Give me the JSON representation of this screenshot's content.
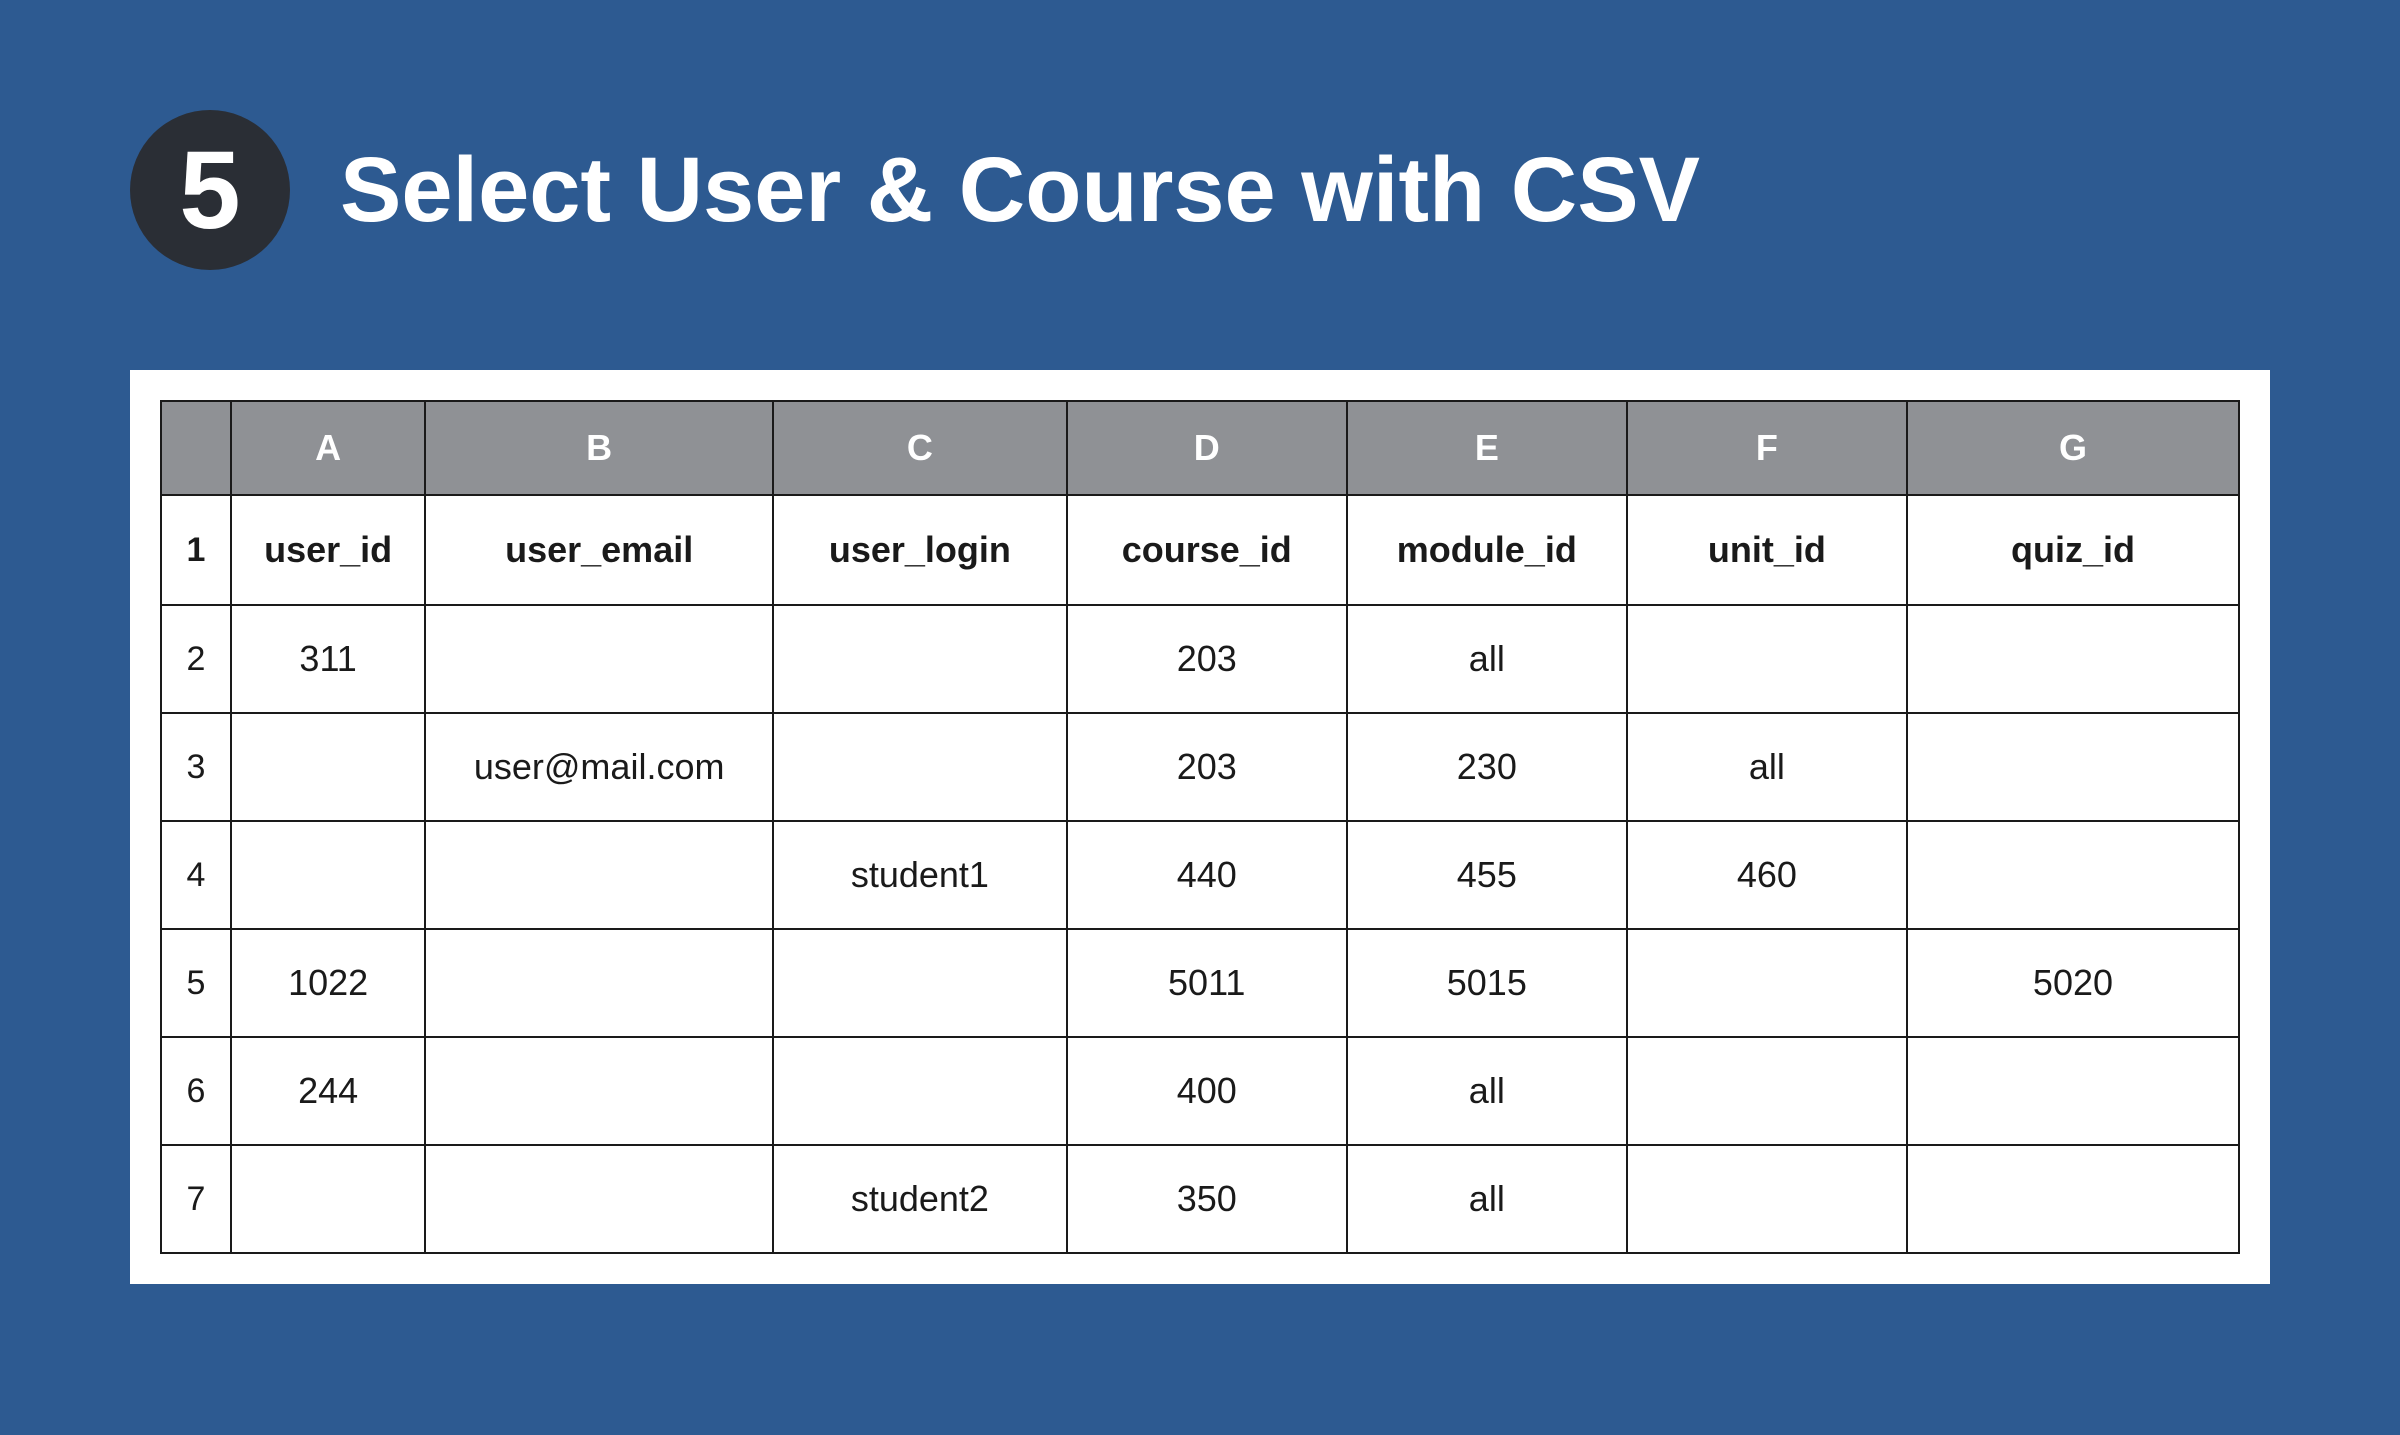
{
  "step": {
    "number": "5",
    "title": "Select User & Course with CSV"
  },
  "spreadsheet": {
    "columns": [
      "A",
      "B",
      "C",
      "D",
      "E",
      "F",
      "G"
    ],
    "rowNumbers": [
      "1",
      "2",
      "3",
      "4",
      "5",
      "6",
      "7"
    ],
    "headerRow": [
      "user_id",
      "user_email",
      "user_login",
      "course_id",
      "module_id",
      "unit_id",
      "quiz_id"
    ],
    "dataRows": [
      [
        "311",
        "",
        "",
        "203",
        "all",
        "",
        ""
      ],
      [
        "",
        "user@mail.com",
        "",
        "203",
        "230",
        "all",
        ""
      ],
      [
        "",
        "",
        "student1",
        "440",
        "455",
        "460",
        ""
      ],
      [
        "1022",
        "",
        "",
        "5011",
        "5015",
        "",
        "5020"
      ],
      [
        "244",
        "",
        "",
        "400",
        "all",
        "",
        ""
      ],
      [
        "",
        "",
        "student2",
        "350",
        "all",
        "",
        ""
      ]
    ]
  }
}
